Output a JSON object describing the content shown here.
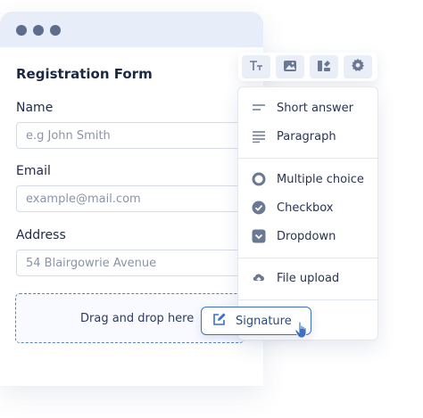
{
  "form": {
    "title": "Registration Form",
    "fields": [
      {
        "label": "Name",
        "placeholder": "e.g John Smith"
      },
      {
        "label": "Email",
        "placeholder": "example@mail.com"
      },
      {
        "label": "Address",
        "placeholder": "54 Blairgowrie Avenue"
      }
    ],
    "dropzone_text": "Drag and drop here",
    "signature_label": "Signature"
  },
  "toolbar": {
    "buttons": [
      "text-format-icon",
      "image-icon",
      "shapes-icon",
      "settings-gear-icon"
    ]
  },
  "menu": {
    "items": [
      {
        "label": "Short answer",
        "icon": "short-answer-icon"
      },
      {
        "label": "Paragraph",
        "icon": "paragraph-icon"
      },
      {
        "label": "Multiple choice",
        "icon": "radio-icon"
      },
      {
        "label": "Checkbox",
        "icon": "checkbox-icon"
      },
      {
        "label": "Dropdown",
        "icon": "dropdown-icon"
      },
      {
        "label": "File upload",
        "icon": "cloud-upload-icon"
      }
    ]
  },
  "colors": {
    "accent": "#3d6fc2",
    "icon": "#6b7892",
    "titlebar": "#e7edf9"
  }
}
